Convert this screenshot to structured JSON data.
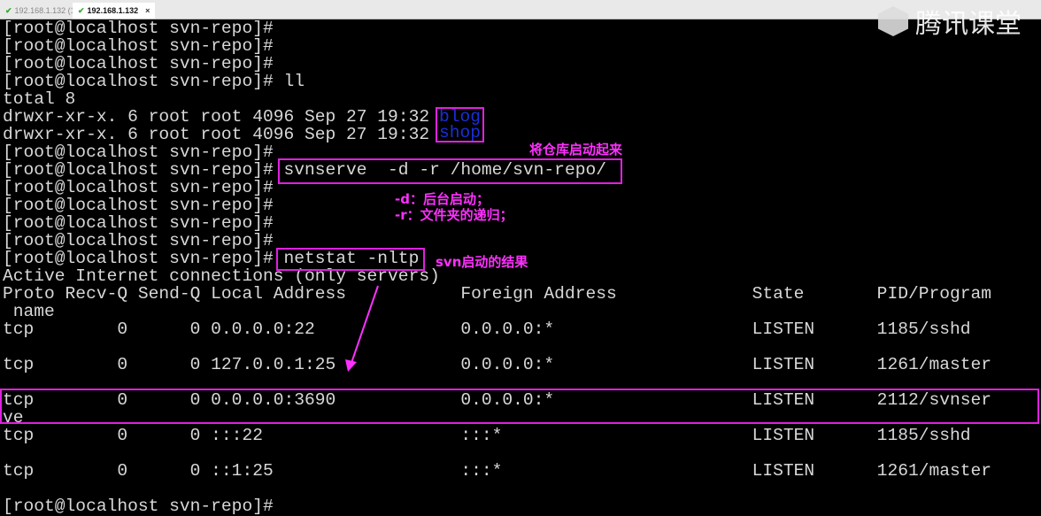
{
  "tabs": [
    {
      "label": "192.168.1.132 (1)",
      "active": false
    },
    {
      "label": "192.168.1.132",
      "active": true,
      "close": "×"
    }
  ],
  "logo": "腾讯课堂",
  "terminal_lines": [
    "[root@localhost svn-repo]#",
    "[root@localhost svn-repo]#",
    "[root@localhost svn-repo]#",
    "[root@localhost svn-repo]# ll",
    "total 8",
    "drwxr-xr-x. 6 root root 4096 Sep 27 19:32",
    "drwxr-xr-x. 6 root root 4096 Sep 27 19:32",
    "[root@localhost svn-repo]#",
    "[root@localhost svn-repo]# svnserve  -d -r /home/svn-repo/",
    "[root@localhost svn-repo]#",
    "[root@localhost svn-repo]#",
    "[root@localhost svn-repo]#",
    "[root@localhost svn-repo]#",
    "[root@localhost svn-repo]# netstat -nltp",
    "Active Internet connections (only servers)",
    "Proto Recv-Q Send-Q Local Address           Foreign Address             State       PID/Program",
    " name",
    "tcp        0      0 0.0.0.0:22              0.0.0.0:*                   LISTEN      1185/sshd",
    "",
    "tcp        0      0 127.0.0.1:25            0.0.0.0:*                   LISTEN      1261/master",
    "",
    "tcp        0      0 0.0.0.0:3690            0.0.0.0:*                   LISTEN      2112/svnser",
    "ve",
    "tcp        0      0 :::22                   :::*                        LISTEN      1185/sshd",
    "",
    "tcp        0      0 ::1:25                  :::*                        LISTEN      1261/master",
    "",
    "[root@localhost svn-repo]#"
  ],
  "dirs": {
    "blog": "blog",
    "shop": "shop"
  },
  "annotations": {
    "start_repo": "将仓库启动起来",
    "d_flag": "-d：后台启动；",
    "r_flag": "-r：文件夹的递归；",
    "svn_result": "svn启动的结果"
  },
  "colors": {
    "highlight": "#e020e0",
    "dir": "#1a2fd8"
  }
}
